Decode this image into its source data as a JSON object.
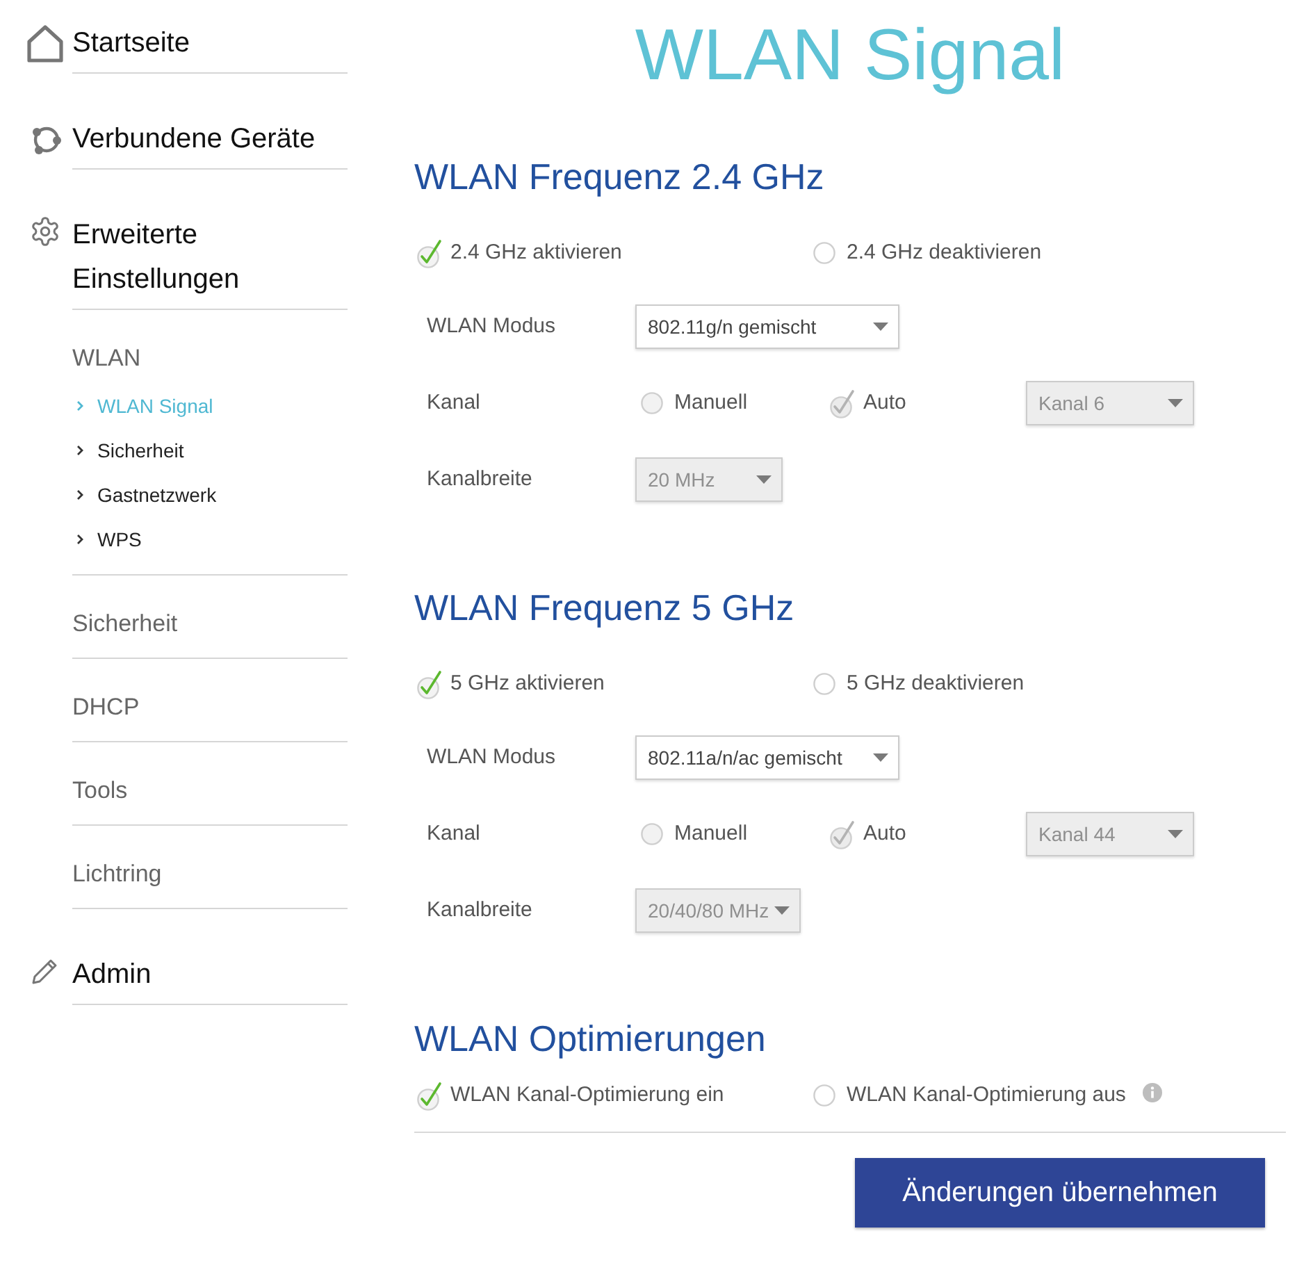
{
  "sidebar": {
    "items": [
      {
        "label": "Startseite"
      },
      {
        "label": "Verbundene Geräte"
      },
      {
        "label": "Erweiterte Einstellungen",
        "children": [
          {
            "label": "WLAN",
            "children": [
              {
                "label": "WLAN Signal",
                "selected": true
              },
              {
                "label": "Sicherheit",
                "selected": false
              },
              {
                "label": "Gastnetzwerk",
                "selected": false
              },
              {
                "label": "WPS",
                "selected": false
              }
            ]
          },
          {
            "label": "Sicherheit"
          },
          {
            "label": "DHCP"
          },
          {
            "label": "Tools"
          },
          {
            "label": "Lichtring"
          }
        ]
      },
      {
        "label": "Admin"
      }
    ]
  },
  "title": "WLAN Signal",
  "sections": [
    {
      "heading": "WLAN Frequenz 2.4 GHz",
      "options": [
        {
          "label": "2.4 GHz aktivieren",
          "selected": true,
          "disabled": false
        },
        {
          "label": "2.4 GHz deaktivieren",
          "selected": false,
          "disabled": false
        }
      ],
      "fields": [
        {
          "kind": "select",
          "label": "WLAN Modus",
          "value": "802.11g/n gemischt",
          "disabled": false
        },
        {
          "kind": "channel",
          "label": "Kanal",
          "options": [
            {
              "label": "Manuell",
              "selected": false,
              "disabled": true
            },
            {
              "label": "Auto",
              "selected": true,
              "disabled": true
            }
          ],
          "dropdown": {
            "value": "Kanal 6",
            "disabled": true
          }
        },
        {
          "kind": "select",
          "label": "Kanalbreite",
          "value": "20 MHz",
          "disabled": true
        }
      ]
    },
    {
      "heading": "WLAN Frequenz 5 GHz",
      "options": [
        {
          "label": "5 GHz aktivieren",
          "selected": true,
          "disabled": false
        },
        {
          "label": "5 GHz deaktivieren",
          "selected": false,
          "disabled": false
        }
      ],
      "fields": [
        {
          "kind": "select",
          "label": "WLAN Modus",
          "value": "802.11a/n/ac gemischt",
          "disabled": false
        },
        {
          "kind": "channel",
          "label": "Kanal",
          "options": [
            {
              "label": "Manuell",
              "selected": false,
              "disabled": true
            },
            {
              "label": "Auto",
              "selected": true,
              "disabled": true
            }
          ],
          "dropdown": {
            "value": "Kanal 44",
            "disabled": true
          }
        },
        {
          "kind": "select",
          "label": "Kanalbreite",
          "value": "20/40/80 MHz",
          "disabled": true
        }
      ]
    },
    {
      "heading": "WLAN Optimierungen",
      "options": [
        {
          "label": "WLAN Kanal-Optimierung ein",
          "selected": true,
          "disabled": false
        },
        {
          "label": "WLAN Kanal-Optimierung aus",
          "selected": false,
          "disabled": false,
          "info": true
        }
      ]
    }
  ],
  "apply_button": "Änderungen übernehmen"
}
